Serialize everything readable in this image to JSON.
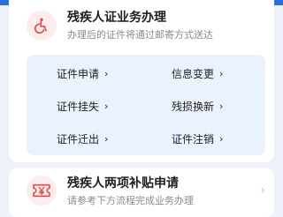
{
  "section1": {
    "icon": "wheelchair-icon",
    "title": "残疾人证业务办理",
    "subtitle": "办理后的证件将通过邮寄方式送达",
    "items": [
      {
        "label": "证件申请",
        "chevron": "›"
      },
      {
        "label": "信息变更",
        "chevron": "›"
      },
      {
        "label": "证件挂失",
        "chevron": "›"
      },
      {
        "label": "残损换新",
        "chevron": "›"
      },
      {
        "label": "证件迁出",
        "chevron": "›"
      },
      {
        "label": "证件注销",
        "chevron": "›"
      }
    ]
  },
  "section2": {
    "icon": "yen-ticket-icon",
    "title": "残疾人两项补贴申请",
    "subtitle": "请参考下方流程完成业务办理",
    "chevron": "›"
  },
  "colors": {
    "accent": "#2c6fd6",
    "icon_red": "#e14b4b",
    "grid_bg": "#eaf2fd"
  }
}
